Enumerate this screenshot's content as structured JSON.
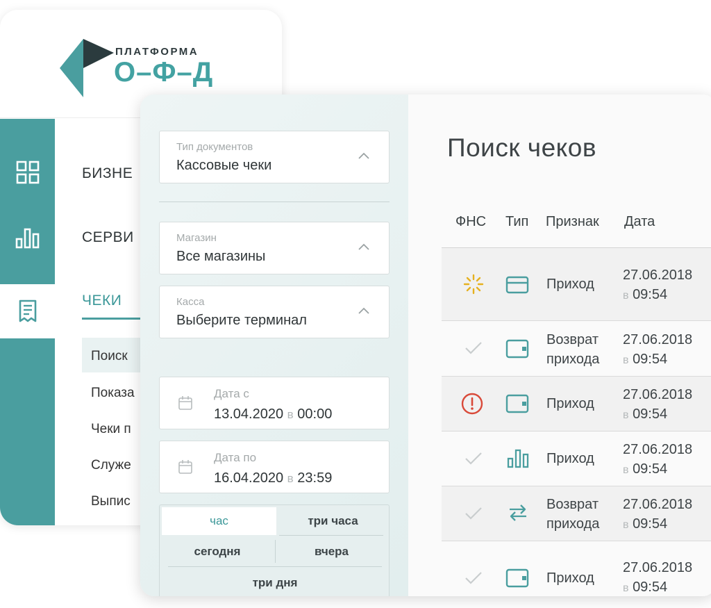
{
  "logo": {
    "top": "ПЛАТФОРМА",
    "bottom": "О–Ф–Д"
  },
  "nav": {
    "rail": [
      {
        "icon": "dashboard-grid-icon"
      },
      {
        "icon": "bar-chart-icon"
      },
      {
        "icon": "receipt-icon",
        "active": true
      }
    ],
    "categories": [
      "БИЗНЕ",
      "СЕРВИ",
      "ЧЕКИ"
    ],
    "sub_items": [
      "Поиск",
      "Показа",
      "Чеки п",
      "Служе",
      "Выпис"
    ]
  },
  "filters": {
    "doc_type": {
      "label": "Тип документов",
      "value": "Кассовые чеки"
    },
    "shop": {
      "label": "Магазин",
      "value": "Все магазины"
    },
    "register": {
      "label": "Касса",
      "value": "Выберите терминал"
    },
    "date_from": {
      "label": "Дата с",
      "date": "13.04.2020",
      "sep": "в",
      "time": "00:00"
    },
    "date_to": {
      "label": "Дата по",
      "date": "16.04.2020",
      "sep": "в",
      "time": "23:59"
    },
    "quick": {
      "hour": "час",
      "three_hours": "три часа",
      "today": "сегодня",
      "yesterday": "вчера",
      "three_days": "три дня"
    }
  },
  "results": {
    "title": "Поиск чеков",
    "headers": {
      "fns": "ФНС",
      "type": "Тип",
      "sign": "Признак",
      "date": "Дата"
    },
    "rows": [
      {
        "fns": "pending-icon",
        "type": "card-icon",
        "sign1": "Приход",
        "sign2": "",
        "date": "27.06.2018",
        "pre": "в",
        "time": "09:54"
      },
      {
        "fns": "check-icon",
        "type": "wallet-icon",
        "sign1": "Возврат",
        "sign2": "прихода",
        "date": "27.06.2018",
        "pre": "в",
        "time": "09:54"
      },
      {
        "fns": "error-icon",
        "type": "wallet-icon",
        "sign1": "Приход",
        "sign2": "",
        "date": "27.06.2018",
        "pre": "в",
        "time": "09:54"
      },
      {
        "fns": "check-icon",
        "type": "chart-icon",
        "sign1": "Приход",
        "sign2": "",
        "date": "27.06.2018",
        "pre": "в",
        "time": "09:54"
      },
      {
        "fns": "check-icon",
        "type": "exchange-icon",
        "sign1": "Возврат",
        "sign2": "прихода",
        "date": "27.06.2018",
        "pre": "в",
        "time": "09:54"
      },
      {
        "fns": "check-icon",
        "type": "wallet-icon",
        "sign1": "Приход",
        "sign2": "",
        "date": "27.06.2018",
        "pre": "в",
        "time": "09:54"
      }
    ]
  },
  "colors": {
    "accent": "#4a9e9f",
    "error": "#d94a3a",
    "pending": "#e6b120"
  }
}
